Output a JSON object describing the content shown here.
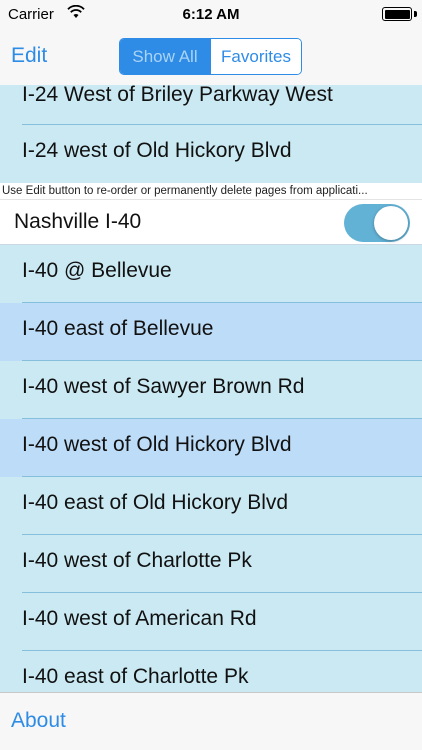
{
  "status_bar": {
    "carrier": "Carrier",
    "wifi_icon": "wifi-icon",
    "time": "6:12 AM",
    "battery_icon": "battery-icon"
  },
  "nav_bar": {
    "edit_label": "Edit",
    "segments": [
      {
        "label": "Show All",
        "selected": true
      },
      {
        "label": "Favorites",
        "selected": false
      }
    ]
  },
  "list": {
    "top_rows": [
      {
        "label": "I-24 West of Briley Parkway West"
      },
      {
        "label": "I-24 west of Old Hickory Blvd"
      }
    ],
    "hint": "Use Edit button to re-order or permanently delete pages from applicati...",
    "group": {
      "title": "Nashville I-40",
      "toggle_on": true
    },
    "rows": [
      {
        "label": "I-40 @ Bellevue",
        "highlighted": false
      },
      {
        "label": "I-40 east of Bellevue",
        "highlighted": true
      },
      {
        "label": "I-40 west of Sawyer Brown Rd",
        "highlighted": false
      },
      {
        "label": "I-40 west of Old Hickory Blvd",
        "highlighted": true
      },
      {
        "label": "I-40 east of Old Hickory Blvd",
        "highlighted": false
      },
      {
        "label": "I-40 west of Charlotte Pk",
        "highlighted": false
      },
      {
        "label": "I-40 west of American Rd",
        "highlighted": false
      },
      {
        "label": "I-40 east of Charlotte Pk",
        "highlighted": false
      }
    ]
  },
  "toolbar": {
    "about_label": "About"
  },
  "colors": {
    "accent": "#2e8ce6",
    "row_background": "#cae9f3",
    "row_highlight": "#bddcf7",
    "toggle_on": "#62b2d6"
  }
}
